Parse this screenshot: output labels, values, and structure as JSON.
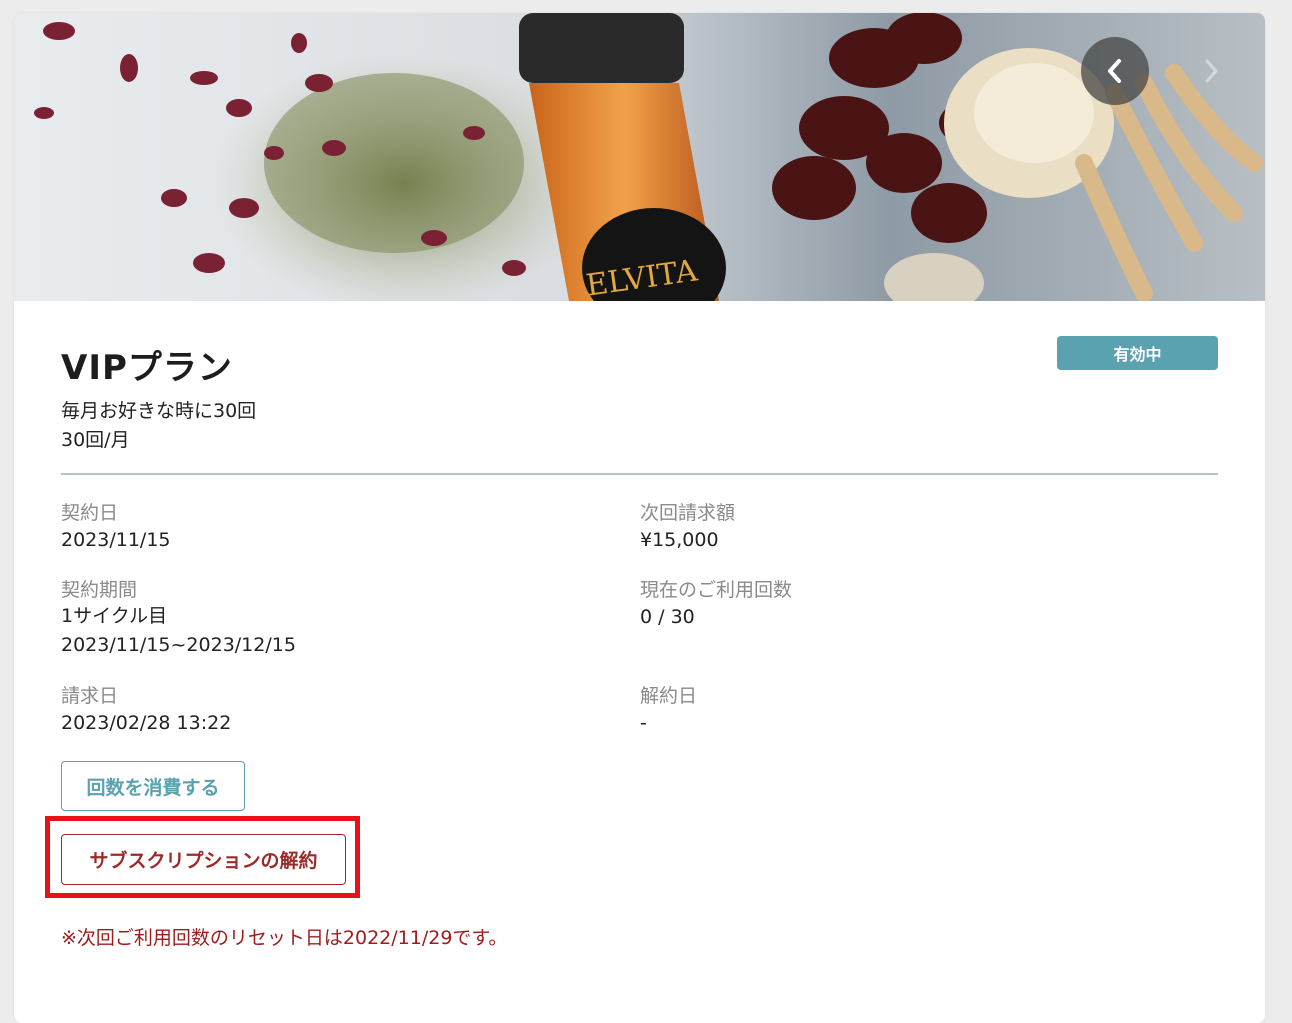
{
  "colors": {
    "accent": "#5aa2b0",
    "danger": "#9b2a2a",
    "highlight": "#e8111a",
    "notice": "#a11c1c"
  },
  "hero": {
    "image_icon": "product-photo",
    "bottle_label": "ELVITA",
    "prev_icon": "chevron-left-icon",
    "next_icon": "chevron-right-icon"
  },
  "plan": {
    "title": "VIPプラン",
    "status": "有効中",
    "description": "毎月お好きな時に30回",
    "frequency": "30回/月"
  },
  "details": {
    "contract_date_label": "契約日",
    "contract_date": "2023/11/15",
    "next_amount_label": "次回請求額",
    "next_amount": "¥15,000",
    "period_label": "契約期間",
    "period_cycle": "1サイクル目",
    "period_range": "2023/11/15~2023/12/15",
    "usage_label": "現在のご利用回数",
    "usage_value": "0 / 30",
    "billing_date_label": "請求日",
    "billing_date": "2023/02/28 13:22",
    "cancel_date_label": "解約日",
    "cancel_date": "-"
  },
  "actions": {
    "consume_label": "回数を消費する",
    "cancel_label": "サブスクリプションの解約"
  },
  "notice": "※次回ご利用回数のリセット日は2022/11/29です。"
}
